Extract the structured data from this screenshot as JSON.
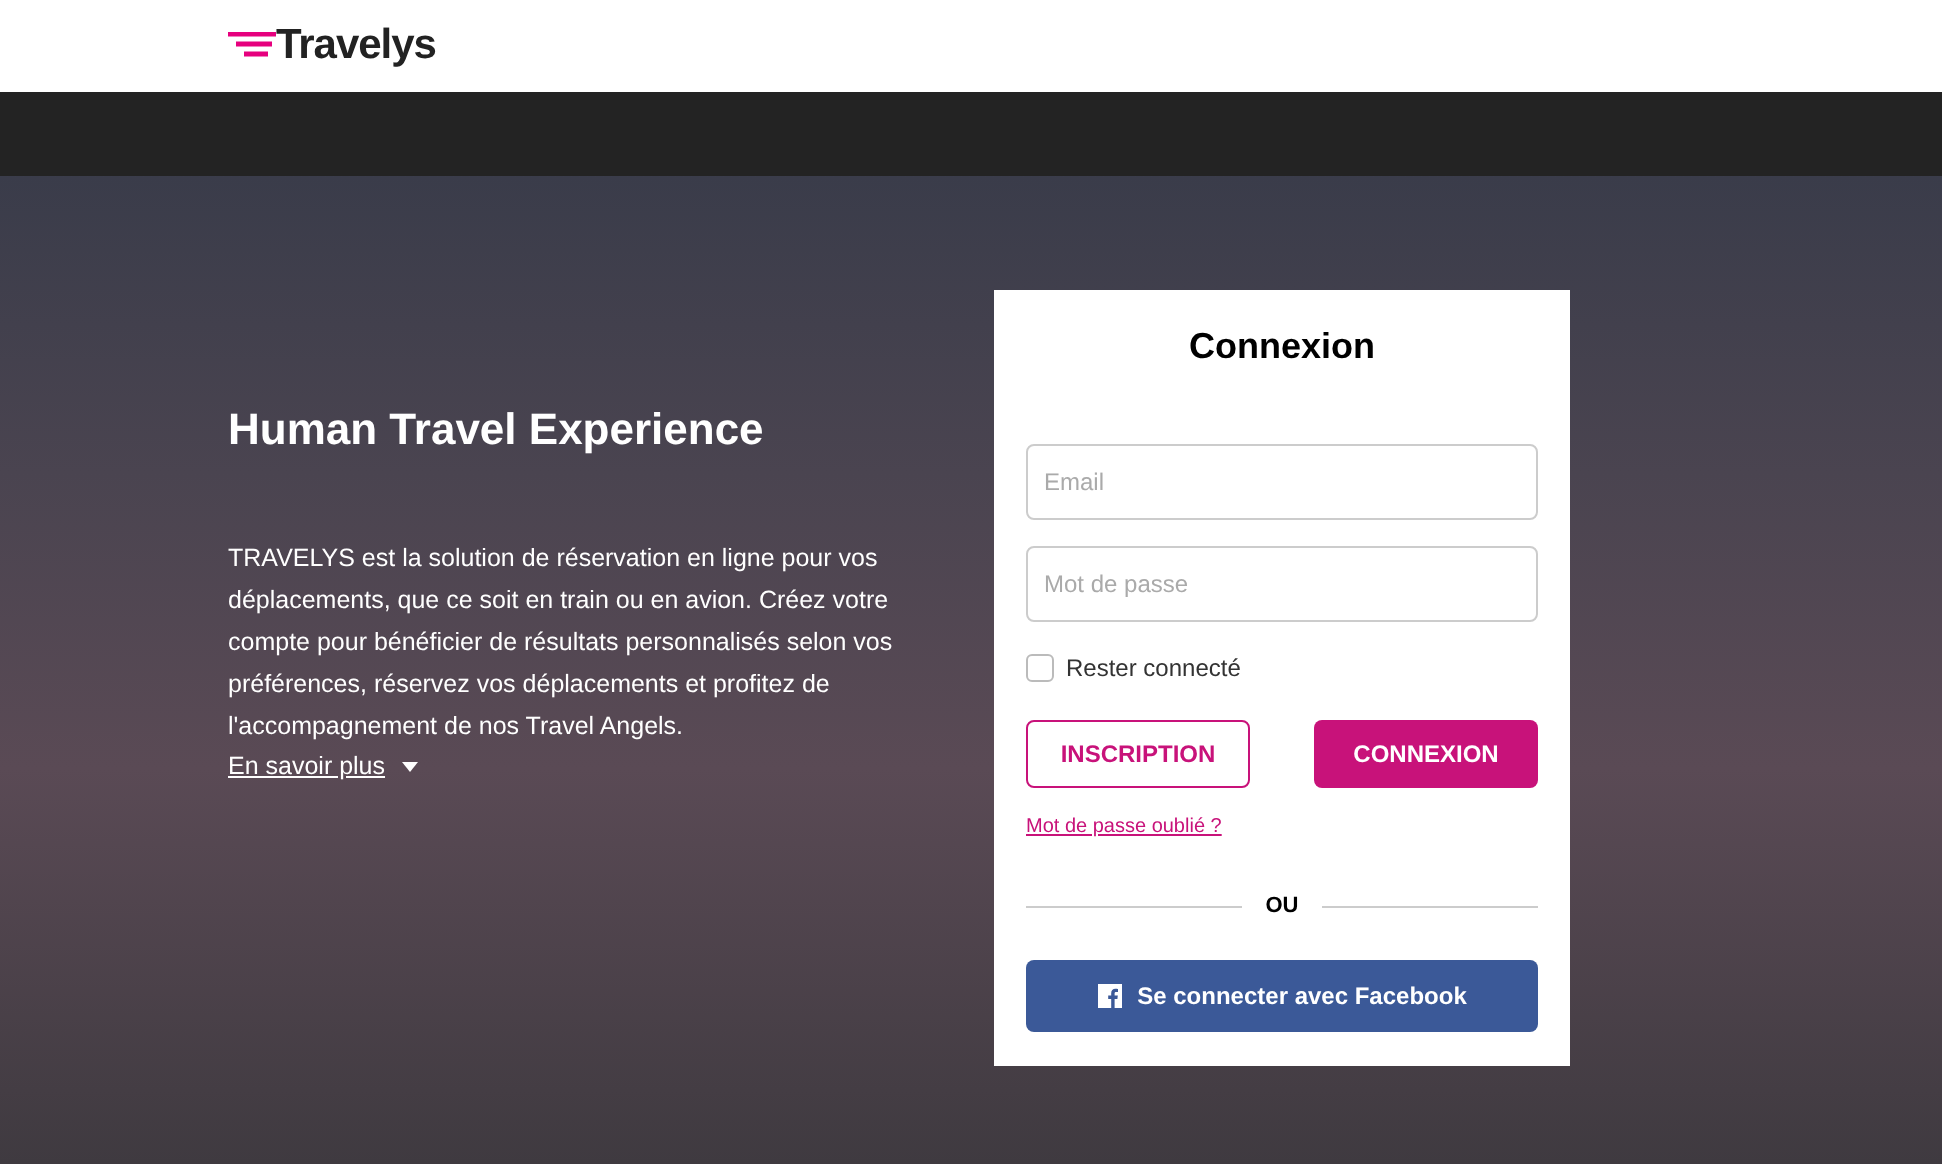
{
  "header": {
    "logo": "Travelys"
  },
  "hero": {
    "title": "Human Travel Experience",
    "description": "TRAVELYS est la solution de réservation en ligne pour vos déplacements, que ce soit en train ou en avion. Créez votre compte pour bénéficier de résultats personnalisés selon vos préférences, réservez vos déplacements et profitez de l'accompagnement de nos Travel Angels.",
    "more_link": "En savoir plus"
  },
  "login": {
    "title": "Connexion",
    "email": {
      "placeholder": "Email"
    },
    "password": {
      "placeholder": "Mot de passe"
    },
    "remember": {
      "label": "Rester connecté",
      "checked": false
    },
    "buttons": [
      {
        "label": "INSCRIPTION",
        "kind": "outline"
      },
      {
        "label": "CONNEXION",
        "kind": "filled"
      }
    ],
    "forgot_link": "Mot de passe oublié ?",
    "separator": "OU",
    "facebook_button": "Se connecter avec Facebook"
  }
}
